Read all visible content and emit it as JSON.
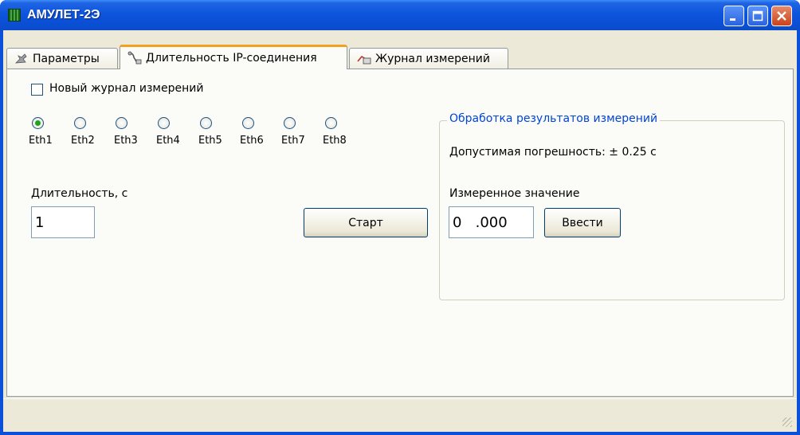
{
  "window": {
    "title": "АМУЛЕТ-2Э",
    "icons": {
      "app": "app-grid-icon",
      "minimize": "minimize-icon",
      "maximize": "maximize-icon",
      "close": "close-icon"
    }
  },
  "tabs": [
    {
      "label": "Параметры",
      "icon": "parameters-icon",
      "active": false
    },
    {
      "label": "Длительность IP-соединения",
      "icon": "connection-icon",
      "active": true
    },
    {
      "label": "Журнал измерений",
      "icon": "journal-icon",
      "active": false
    }
  ],
  "main": {
    "new_journal_checkbox": {
      "label": "Новый журнал измерений",
      "checked": false
    },
    "eth": [
      {
        "label": "Eth1",
        "checked": true
      },
      {
        "label": "Eth2",
        "checked": false
      },
      {
        "label": "Eth3",
        "checked": false
      },
      {
        "label": "Eth4",
        "checked": false
      },
      {
        "label": "Eth5",
        "checked": false
      },
      {
        "label": "Eth6",
        "checked": false
      },
      {
        "label": "Eth7",
        "checked": false
      },
      {
        "label": "Eth8",
        "checked": false
      }
    ],
    "duration": {
      "label": "Длительность, с",
      "value": "1"
    },
    "start_button": "Старт"
  },
  "results": {
    "title": "Обработка результатов измерений",
    "tolerance": "Допустимая погрешность: ± 0.25 с",
    "measured_label": "Измеренное значение",
    "measured_value": "0   .000",
    "enter_button": "Ввести"
  },
  "colors": {
    "titlebar": "#0a4ed4",
    "active_tab_accent": "#f3a020",
    "group_title": "#0046d5",
    "radio_checked": "#21a121"
  }
}
